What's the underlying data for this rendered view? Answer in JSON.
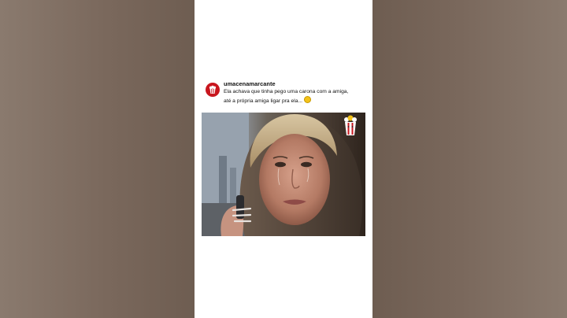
{
  "post": {
    "username": "umacenamarcante",
    "caption": "Ela achava que tinha pego uma carona com a amiga,\naté a própria amiga ligar pra ela...",
    "caption_emoji": "crying-face",
    "avatar_icon": "popcorn-icon",
    "accent_color": "#c8161e"
  },
  "video": {
    "watermark_icon": "popcorn-icon"
  }
}
